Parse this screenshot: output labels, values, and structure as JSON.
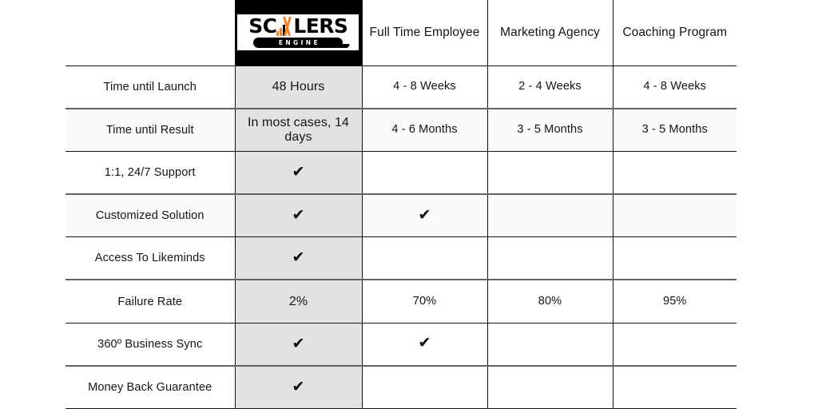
{
  "table": {
    "logo": {
      "name": "scalers-engine-logo",
      "word_pre": "SC",
      "word_post": "LERS",
      "tagline": "ENGINE",
      "accent_color": "#f5821f",
      "plate_bg": "#ffffff",
      "cell_bg": "#000000"
    },
    "highlight_color": "#e2e2e2",
    "columns": [
      {
        "key": "label",
        "label": ""
      },
      {
        "key": "scalers",
        "label": "Scalers Engine"
      },
      {
        "key": "ft",
        "label": "Full Time Employee"
      },
      {
        "key": "ma",
        "label": "Marketing Agency"
      },
      {
        "key": "cp",
        "label": "Coaching Program"
      }
    ],
    "check_glyph": "✔",
    "rows": [
      {
        "label": "Time until Launch",
        "scalers": "48 Hours",
        "ft": "4 - 8 Weeks",
        "ma": "2 - 4 Weeks",
        "cp": "4 - 8 Weeks"
      },
      {
        "label": "Time until Result",
        "scalers": "In most cases, 14 days",
        "ft": "4 - 6 Months",
        "ma": "3 - 5 Months",
        "cp": "3 - 5 Months"
      },
      {
        "label": "1:1, 24/7 Support",
        "scalers": "✔",
        "ft": "",
        "ma": "",
        "cp": ""
      },
      {
        "label": "Customized Solution",
        "scalers": "✔",
        "ft": "✔",
        "ma": "",
        "cp": ""
      },
      {
        "label": "Access To Likeminds",
        "scalers": "✔",
        "ft": "",
        "ma": "",
        "cp": ""
      },
      {
        "label": "Failure Rate",
        "scalers": "2%",
        "ft": "70%",
        "ma": "80%",
        "cp": "95%"
      },
      {
        "label": "360º Business Sync",
        "scalers": "✔",
        "ft": "✔",
        "ma": "",
        "cp": ""
      },
      {
        "label": "Money Back Guarantee",
        "scalers": "✔",
        "ft": "",
        "ma": "",
        "cp": ""
      }
    ]
  }
}
